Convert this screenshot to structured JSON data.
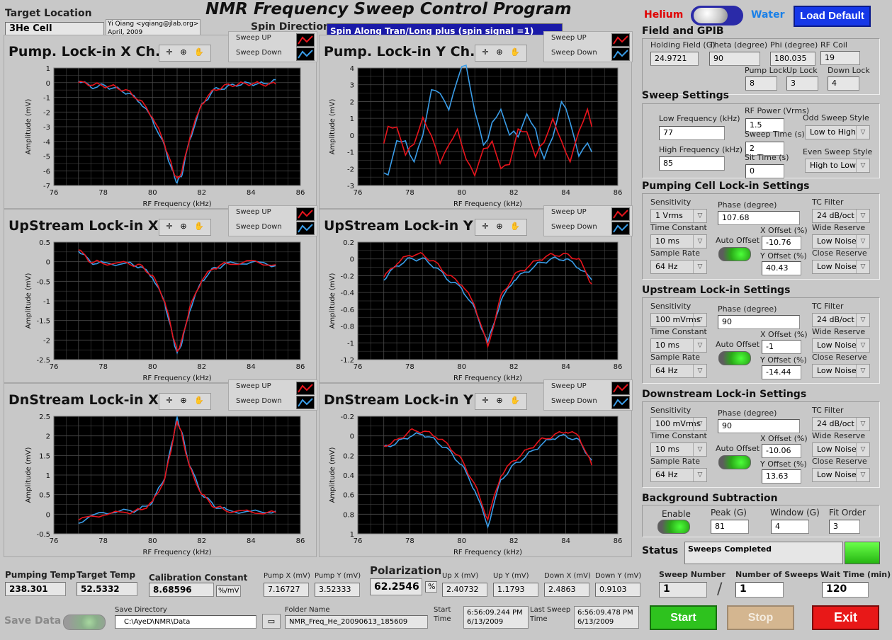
{
  "header": {
    "title": "NMR Frequency Sweep Control Program",
    "target_location_label": "Target Location",
    "target_location_value": "3He Cell",
    "author_line1": "Yi Qiang <yqiang@jlab.org>",
    "author_line2": "April, 2009",
    "spin_direction_label": "Spin Direction",
    "spin_direction_value": "Spin Along Tran/Long plus (spin signal =1)",
    "helium_label": "Helium",
    "water_label": "Water",
    "load_default_label": "Load Default"
  },
  "legend": {
    "up": "Sweep UP",
    "down": "Sweep Down"
  },
  "colors": {
    "up": "#e8141c",
    "down": "#3a9de8",
    "plot_bg": "#000000",
    "grid": "#4a4a4a"
  },
  "plots": [
    {
      "id": "pump-x",
      "title": "Pump. Lock-in X Ch.",
      "xlabel": "RF Frequency (kHz)",
      "ylabel": "Amplitude (mV)",
      "xticks": [
        "76",
        "78",
        "80",
        "82",
        "84",
        "86"
      ],
      "yticks": [
        "1",
        "0",
        "-1",
        "-2",
        "-3",
        "-4",
        "-5",
        "-6",
        "-7"
      ]
    },
    {
      "id": "pump-y",
      "title": "Pump. Lock-in Y Ch.",
      "xlabel": "RF Frequency (kHz)",
      "ylabel": "Amplitude (mV)",
      "xticks": [
        "76",
        "78",
        "80",
        "82",
        "84",
        "86"
      ],
      "yticks": [
        "4",
        "3",
        "2",
        "1",
        "0",
        "-1",
        "-2",
        "-3"
      ]
    },
    {
      "id": "up-x",
      "title": "UpStream Lock-in X",
      "xlabel": "RF Frequency (kHz)",
      "ylabel": "Amplitude (mV)",
      "xticks": [
        "76",
        "78",
        "80",
        "82",
        "84",
        "86"
      ],
      "yticks": [
        "0.5",
        "0",
        "-0.5",
        "-1",
        "-1.5",
        "-2",
        "-2.5"
      ]
    },
    {
      "id": "up-y",
      "title": "UpStream Lock-in Y",
      "xlabel": "RF Frequency (kHz)",
      "ylabel": "Amplitude (mV)",
      "xticks": [
        "76",
        "78",
        "80",
        "82",
        "84",
        "86"
      ],
      "yticks": [
        "0.2",
        "0",
        "-0.2",
        "-0.4",
        "-0.6",
        "-0.8",
        "-1",
        "-1.2"
      ]
    },
    {
      "id": "dn-x",
      "title": "DnStream Lock-in X",
      "xlabel": "RF Frequency (kHz)",
      "ylabel": "Amplitude (mV)",
      "xticks": [
        "76",
        "78",
        "80",
        "82",
        "84",
        "86"
      ],
      "yticks": [
        "2.5",
        "2",
        "1.5",
        "1",
        "0.5",
        "0",
        "-0.5"
      ]
    },
    {
      "id": "dn-y",
      "title": "DnStream Lock-in Y",
      "xlabel": "RF Frequency (kHz)",
      "ylabel": "Amplitude (mV)",
      "xticks": [
        "76",
        "78",
        "80",
        "82",
        "84",
        "86"
      ],
      "yticks": [
        "-0.2",
        "0",
        "0.2",
        "0.4",
        "0.6",
        "0.8",
        "1"
      ]
    }
  ],
  "chart_data": [
    {
      "type": "line",
      "title": "Pump. Lock-in X Ch.",
      "xlabel": "RF Frequency (kHz)",
      "ylabel": "Amplitude (mV)",
      "xlim": [
        76,
        86
      ],
      "ylim": [
        -7,
        1
      ],
      "series": [
        {
          "name": "Sweep UP",
          "x": [
            77,
            77.5,
            78,
            78.5,
            79,
            79.5,
            80,
            80.5,
            80.8,
            81,
            81.2,
            81.5,
            82,
            82.5,
            83,
            83.5,
            84,
            84.5,
            85
          ],
          "y": [
            0,
            -0.1,
            -0.2,
            -0.3,
            -0.6,
            -1.2,
            -2.3,
            -4.2,
            -5.8,
            -6.6,
            -6,
            -3.8,
            -1.4,
            -0.5,
            -0.2,
            -0.1,
            -0.05,
            -0.1,
            -0.1
          ]
        },
        {
          "name": "Sweep Down",
          "x": [
            77,
            77.5,
            78,
            78.5,
            79,
            79.5,
            80,
            80.5,
            80.8,
            81,
            81.2,
            81.5,
            82,
            82.5,
            83,
            83.5,
            84,
            84.5,
            85
          ],
          "y": [
            0.2,
            -0.3,
            -0.2,
            -0.4,
            -0.7,
            -1.3,
            -2.5,
            -4.4,
            -6,
            -6.8,
            -6.2,
            -3.9,
            -1.5,
            -0.5,
            -0.3,
            -0.1,
            -0.05,
            -0.1,
            0.2
          ]
        }
      ]
    },
    {
      "type": "line",
      "title": "Pump. Lock-in Y Ch.",
      "xlabel": "RF Frequency (kHz)",
      "ylabel": "Amplitude (mV)",
      "xlim": [
        76,
        86
      ],
      "ylim": [
        -3,
        4
      ],
      "series": [
        {
          "name": "Sweep UP",
          "x": [
            77,
            78,
            79,
            80,
            81,
            82,
            83,
            84,
            85
          ],
          "y": [
            -0.5,
            0,
            -0.3,
            -1,
            -1.5,
            -0.8,
            0,
            -0.5,
            0.5
          ]
        },
        {
          "name": "Sweep Down",
          "x": [
            77,
            78,
            79,
            80,
            81,
            82,
            83,
            84,
            85
          ],
          "y": [
            -1.5,
            -1,
            2,
            3.5,
            0,
            1,
            -0.5,
            1,
            -1
          ]
        }
      ]
    },
    {
      "type": "line",
      "title": "UpStream Lock-in X",
      "xlabel": "RF Frequency (kHz)",
      "ylabel": "Amplitude (mV)",
      "xlim": [
        76,
        86
      ],
      "ylim": [
        -2.5,
        0.5
      ],
      "series": [
        {
          "name": "Sweep UP",
          "x": [
            77,
            77.5,
            78,
            79,
            79.5,
            80,
            80.5,
            80.8,
            81,
            81.2,
            81.5,
            82,
            82.5,
            83,
            84,
            85
          ],
          "y": [
            0.3,
            0,
            -0.03,
            -0.05,
            -0.1,
            -0.35,
            -1,
            -1.8,
            -2.3,
            -2,
            -1.2,
            -0.45,
            -0.15,
            -0.05,
            0,
            -0.08
          ]
        },
        {
          "name": "Sweep Down",
          "x": [
            77,
            77.5,
            78,
            79,
            79.5,
            80,
            80.5,
            80.8,
            81,
            81.2,
            81.5,
            82,
            82.5,
            83,
            84,
            85
          ],
          "y": [
            0.3,
            -0.02,
            -0.04,
            -0.05,
            -0.12,
            -0.38,
            -1.05,
            -1.85,
            -2.35,
            -2.05,
            -1.25,
            -0.48,
            -0.17,
            -0.06,
            -0.01,
            -0.1
          ]
        }
      ]
    },
    {
      "type": "line",
      "title": "UpStream Lock-in Y",
      "xlabel": "RF Frequency (kHz)",
      "ylabel": "Amplitude (mV)",
      "xlim": [
        76,
        86
      ],
      "ylim": [
        -1.2,
        0.2
      ],
      "series": [
        {
          "name": "Sweep UP",
          "x": [
            77,
            77.5,
            78,
            78.5,
            79,
            79.5,
            80,
            80.5,
            81,
            81.5,
            82,
            82.5,
            83,
            83.5,
            84,
            84.5,
            85
          ],
          "y": [
            -0.22,
            -0.05,
            0.05,
            0.05,
            -0.05,
            -0.2,
            -0.3,
            -0.55,
            -1.05,
            -0.45,
            -0.2,
            -0.1,
            0,
            0.05,
            0.05,
            0,
            -0.3
          ]
        },
        {
          "name": "Sweep Down",
          "x": [
            77,
            77.5,
            78,
            78.5,
            79,
            79.5,
            80,
            80.5,
            81,
            81.5,
            82,
            82.5,
            83,
            83.5,
            84,
            84.5,
            85
          ],
          "y": [
            -0.24,
            -0.08,
            0,
            0,
            -0.1,
            -0.25,
            -0.35,
            -0.6,
            -1,
            -0.5,
            -0.25,
            -0.15,
            -0.05,
            0,
            0,
            -0.1,
            -0.25
          ]
        }
      ]
    },
    {
      "type": "line",
      "title": "DnStream Lock-in X",
      "xlabel": "RF Frequency (kHz)",
      "ylabel": "Amplitude (mV)",
      "xlim": [
        76,
        86
      ],
      "ylim": [
        -0.5,
        2.5
      ],
      "series": [
        {
          "name": "Sweep UP",
          "x": [
            77,
            78,
            79,
            79.5,
            80,
            80.5,
            80.8,
            81,
            81.2,
            81.5,
            82,
            82.5,
            83,
            84,
            85
          ],
          "y": [
            -0.15,
            0,
            0.05,
            0.1,
            0.3,
            0.9,
            1.8,
            2.4,
            2,
            1.2,
            0.5,
            0.2,
            0.1,
            0.05,
            0.05
          ]
        },
        {
          "name": "Sweep Down",
          "x": [
            77,
            78,
            79,
            79.5,
            80,
            80.5,
            80.8,
            81,
            81.2,
            81.5,
            82,
            82.5,
            83,
            84,
            85
          ],
          "y": [
            -0.2,
            0.05,
            0.08,
            0.12,
            0.32,
            0.95,
            1.85,
            2.45,
            2.05,
            1.25,
            0.52,
            0.22,
            0.1,
            0.05,
            0.08
          ]
        }
      ]
    },
    {
      "type": "line",
      "title": "DnStream Lock-in Y",
      "xlabel": "RF Frequency (kHz)",
      "ylabel": "Amplitude (mV)",
      "xlim": [
        76,
        86
      ],
      "ylim": [
        1,
        -0.2
      ],
      "series": [
        {
          "name": "Sweep UP",
          "x": [
            77,
            77.5,
            78,
            78.5,
            79,
            79.5,
            80,
            80.5,
            81,
            81.5,
            82,
            82.5,
            83,
            83.5,
            84,
            84.5,
            85
          ],
          "y": [
            0.1,
            0.05,
            -0.05,
            -0.05,
            0,
            0.1,
            0.25,
            0.5,
            0.85,
            0.4,
            0.25,
            0.15,
            0.05,
            0,
            -0.05,
            0,
            0.3
          ]
        },
        {
          "name": "Sweep Down",
          "x": [
            77,
            77.5,
            78,
            78.5,
            79,
            79.5,
            80,
            80.5,
            81,
            81.5,
            82,
            82.5,
            83,
            83.5,
            84,
            84.5,
            85
          ],
          "y": [
            0.12,
            0.07,
            0,
            -0.02,
            0.05,
            0.15,
            0.3,
            0.55,
            0.92,
            0.45,
            0.3,
            0.2,
            0.1,
            0.02,
            0,
            0.05,
            0.25
          ]
        }
      ]
    }
  ],
  "field_gpib": {
    "title": "Field and GPIB",
    "holding_field_label": "Holding Field (G)",
    "holding_field": "24.9721",
    "theta_label": "Theta (degree)",
    "theta": "90",
    "phi_label": "Phi (degree)",
    "phi": "180.035",
    "rf_coil_label": "RF Coil",
    "rf_coil": "19",
    "pump_lock_label": "Pump Lock",
    "pump_lock": "8",
    "up_lock_label": "Up Lock",
    "up_lock": "3",
    "down_lock_label": "Down Lock",
    "down_lock": "4"
  },
  "sweep": {
    "title": "Sweep Settings",
    "low_freq_label": "Low Frequency (kHz)",
    "low_freq": "77",
    "high_freq_label": "High Frequency (kHz)",
    "high_freq": "85",
    "rf_power_label": "RF Power (Vrms)",
    "rf_power": "1.5",
    "sweep_time_label": "Sweep Time (s)",
    "sweep_time": "2",
    "sit_time_label": "Sit Time (s)",
    "sit_time": "0",
    "odd_label": "Odd Sweep Style",
    "odd": "Low to High",
    "even_label": "Even Sweep Style",
    "even": "High to Low"
  },
  "lockins": [
    {
      "title": "Pumping Cell Lock-in Settings",
      "sensitivity": "1 Vrms",
      "phase": "107.68",
      "tc_filter": "24 dB/oct",
      "time_constant": "10 ms",
      "x_offset": "-10.76",
      "wide_reserve": "Low Noise",
      "sample_rate": "64 Hz",
      "y_offset": "40.43",
      "close_reserve": "Low Noise"
    },
    {
      "title": "Upstream Lock-in Settings",
      "sensitivity": "100 mVrms",
      "phase": "90",
      "tc_filter": "24 dB/oct",
      "time_constant": "10 ms",
      "x_offset": "-1",
      "wide_reserve": "Low Noise",
      "sample_rate": "64 Hz",
      "y_offset": "-14.44",
      "close_reserve": "Low Noise"
    },
    {
      "title": "Downstream Lock-in Settings",
      "sensitivity": "100 mVrms",
      "phase": "90",
      "tc_filter": "24 dB/oct",
      "time_constant": "10 ms",
      "x_offset": "-10.06",
      "wide_reserve": "Low Noise",
      "sample_rate": "64 Hz",
      "y_offset": "13.63",
      "close_reserve": "Low Noise"
    }
  ],
  "lockin_labels": {
    "sensitivity": "Sensitivity",
    "phase": "Phase (degree)",
    "tc_filter": "TC Filter",
    "time_constant": "Time Constant",
    "auto_offset": "Auto Offset",
    "x_offset": "X Offset (%)",
    "wide_reserve": "Wide Reserve",
    "sample_rate": "Sample Rate",
    "y_offset": "Y Offset (%)",
    "close_reserve": "Close Reserve"
  },
  "background": {
    "title": "Background Subtraction",
    "enable_label": "Enable",
    "peak_label": "Peak (G)",
    "peak": "81",
    "window_label": "Window (G)",
    "window": "4",
    "fit_order_label": "Fit Order",
    "fit_order": "3"
  },
  "status": {
    "label": "Status",
    "value": "Sweeps Completed"
  },
  "bottom": {
    "pumping_temp_label": "Pumping Temp",
    "pumping_temp": "238.301",
    "target_temp_label": "Target Temp",
    "target_temp": "52.5332",
    "calib_label": "Calibration Constant",
    "calib": "8.68596",
    "calib_unit": "%/mV",
    "pump_x_label": "Pump X (mV)",
    "pump_x": "7.16727",
    "pump_y_label": "Pump Y (mV)",
    "pump_y": "3.52333",
    "polarization_label": "Polarization",
    "polarization": "62.2546",
    "pol_unit": "%",
    "up_x_label": "Up X (mV)",
    "up_x": "2.40732",
    "up_y_label": "Up Y (mV)",
    "up_y": "1.1793",
    "down_x_label": "Down X (mV)",
    "down_x": "2.4863",
    "down_y_label": "Down Y (mV)",
    "down_y": "0.9103",
    "sweep_number_label": "Sweep Number",
    "sweep_number": "1",
    "num_sweeps_label": "Number of Sweeps",
    "num_sweeps": "1",
    "wait_time_label": "Wait Time (min)",
    "wait_time": "120",
    "save_data_label": "Save Data",
    "save_dir_label": "Save Directory",
    "save_dir": "C:\\AyeD\\NMR\\Data",
    "folder_label": "Folder Name",
    "folder": "NMR_Freq_He_20090613_185609",
    "start_time_label_1": "Start",
    "start_time_label_2": "Time",
    "start_time_1": "6:56:09.244 PM",
    "start_time_2": "6/13/2009",
    "last_sweep_label_1": "Last Sweep",
    "last_sweep_label_2": "Time",
    "last_sweep_1": "6:56:09.478 PM",
    "last_sweep_2": "6/13/2009",
    "start_btn": "Start",
    "stop_btn": "Stop",
    "exit_btn": "Exit"
  }
}
